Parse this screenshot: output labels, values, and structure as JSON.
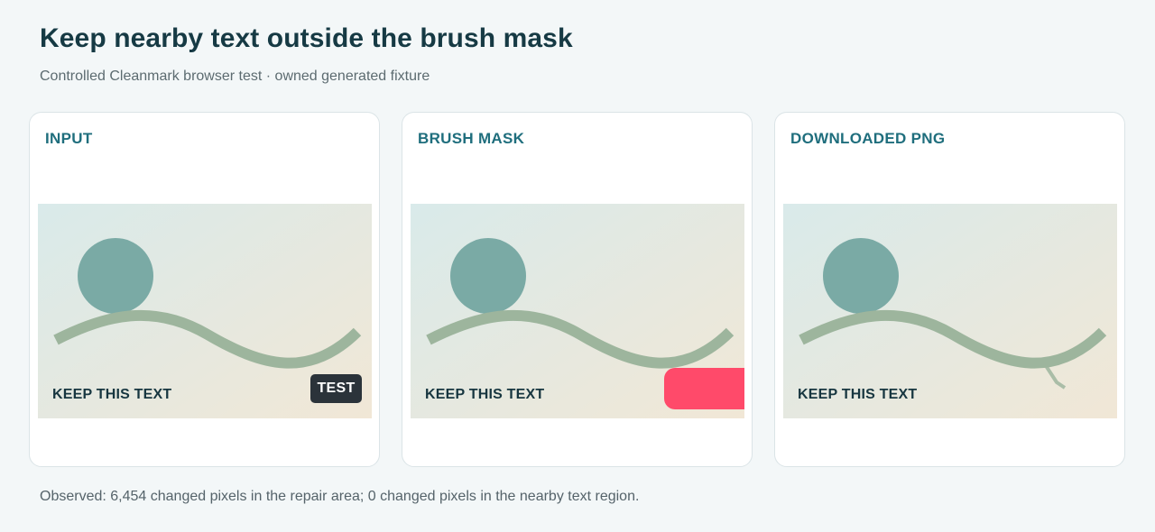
{
  "page": {
    "title": "Keep nearby text outside the brush mask",
    "subtitle": "Controlled Cleanmark browser test · owned generated fixture",
    "observation": "Observed: 6,454 changed pixels in the repair area; 0 changed pixels in the nearby text region."
  },
  "panels": [
    {
      "heading": "INPUT",
      "fixture_text": "KEEP THIS TEXT",
      "badge_text": "TEST"
    },
    {
      "heading": "BRUSH MASK",
      "fixture_text": "KEEP THIS TEXT"
    },
    {
      "heading": "DOWNLOADED PNG",
      "fixture_text": "KEEP THIS TEXT"
    }
  ],
  "colors": {
    "background": "#f3f7f8",
    "title": "#163a44",
    "heading": "#1f6e7d",
    "fixture_gradient_start": "#d9eaea",
    "fixture_gradient_end": "#f1e7d6",
    "circle": "#7aaaa5",
    "wave": "#9db59d",
    "badge": "#2b333a",
    "brush_mask": "#ff4a6a"
  },
  "icons": {
    "fixture_circle": "circle-shape",
    "fixture_wave": "wave-shape"
  }
}
